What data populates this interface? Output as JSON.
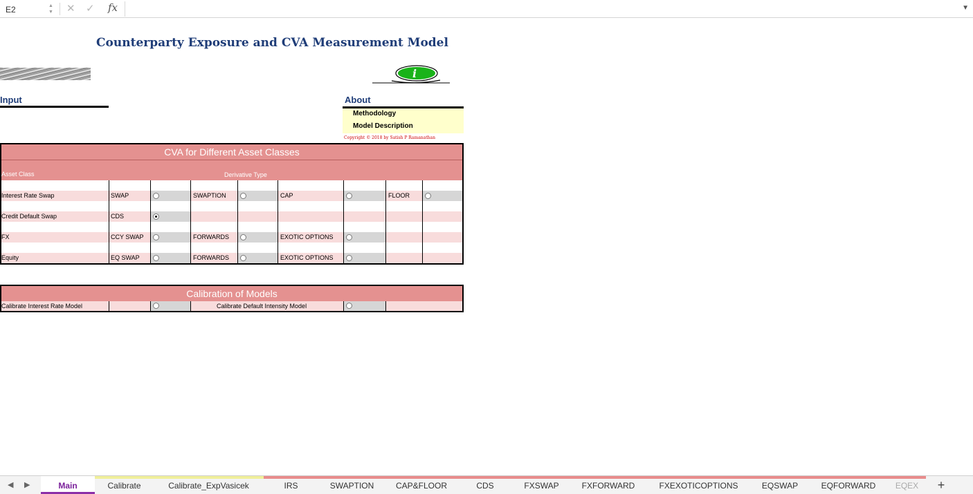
{
  "formula_bar": {
    "cell_ref": "E2",
    "fx_label": "fx",
    "formula": ""
  },
  "sheet": {
    "title": "Counterparty Exposure and CVA Measurement Model",
    "input_heading": "Input",
    "about_heading": "About",
    "about_links": [
      "Methodology",
      "Model Description"
    ],
    "copyright": "Copyright © 2018 by Satish P Ramanathan"
  },
  "cva_table": {
    "title": "CVA for Different Asset Classes",
    "asset_class_header": "Asset Class",
    "derivative_type_header": "Derivative Type",
    "rows": [
      {
        "asset_class": "Interest Rate Swap",
        "d1": "SWAP",
        "d2": "SWAPTION",
        "d3": "CAP",
        "d4": "FLOOR"
      },
      {
        "asset_class": "Credit Default Swap",
        "d1": "CDS",
        "d2": "",
        "d3": "",
        "d4": ""
      },
      {
        "asset_class": "FX",
        "d1": "CCY SWAP",
        "d2": "FORWARDS",
        "d3": "EXOTIC OPTIONS",
        "d4": ""
      },
      {
        "asset_class": "Equity",
        "d1": "EQ SWAP",
        "d2": "FORWARDS",
        "d3": "EXOTIC OPTIONS",
        "d4": ""
      }
    ],
    "selected_option": "CDS"
  },
  "calibration": {
    "title": "Calibration of Models",
    "rate_label": "Calibrate Interest Rate Model",
    "intensity_label": "Calibrate Default Intensity Model"
  },
  "tabs": [
    {
      "label": "Main",
      "active": true,
      "color": "#8b2fa8"
    },
    {
      "label": "Calibrate",
      "active": false,
      "color": "#f0ef9a"
    },
    {
      "label": "Calibrate_ExpVasicek",
      "active": false,
      "color": "#f0ef9a"
    },
    {
      "label": "IRS",
      "active": false,
      "color": "#e88c8c"
    },
    {
      "label": "SWAPTION",
      "active": false,
      "color": "#e88c8c"
    },
    {
      "label": "CAP&FLOOR",
      "active": false,
      "color": "#e88c8c"
    },
    {
      "label": "CDS",
      "active": false,
      "color": "#e88c8c"
    },
    {
      "label": "FXSWAP",
      "active": false,
      "color": "#e88c8c"
    },
    {
      "label": "FXFORWARD",
      "active": false,
      "color": "#e88c8c"
    },
    {
      "label": "FXEXOTICOPTIONS",
      "active": false,
      "color": "#e88c8c"
    },
    {
      "label": "EQSWAP",
      "active": false,
      "color": "#e88c8c"
    },
    {
      "label": "EQFORWARD",
      "active": false,
      "color": "#e88c8c"
    },
    {
      "label": "EQEX",
      "active": false,
      "color": "#e88c8c"
    }
  ],
  "colors": {
    "header_pink": "#e49190",
    "row_pink": "#f8dcdc",
    "title_blue": "#1f3d78",
    "about_yellow": "#ffffcc"
  }
}
